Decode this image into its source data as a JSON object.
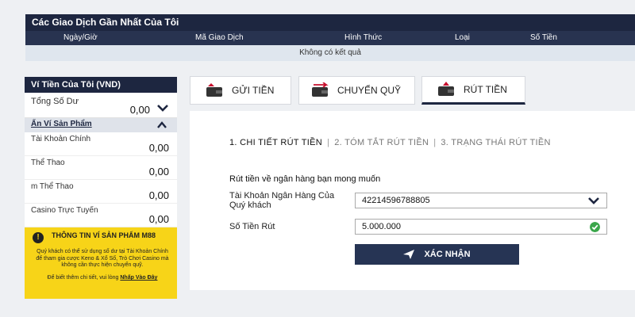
{
  "transactions": {
    "title": "Các Giao Dịch Gần Nhất Của Tôi",
    "columns": [
      "Ngày/Giờ",
      "Mã Giao Dịch",
      "Hình Thức",
      "Loại",
      "Số Tiền"
    ],
    "empty_text": "Không có kết quả"
  },
  "wallet": {
    "title": "Ví Tiền Của Tôi (VND)",
    "total_label": "Tổng Số Dư",
    "total_value": "0,00",
    "hide_label": "Ẩn Ví Sản Phẩm",
    "items": [
      {
        "label": "Tài Khoản Chính",
        "value": "0,00"
      },
      {
        "label": "Thể Thao",
        "value": "0,00"
      },
      {
        "label": "m Thể Thao",
        "value": "0,00"
      },
      {
        "label": "Casino Trực Tuyến",
        "value": "0,00"
      }
    ],
    "info": {
      "title": "THÔNG TIN VÍ SẢN PHẨM M88",
      "body": "Quý khách có thể sử dụng số dư tại Tài Khoản Chính để tham gia cược Keno & Xổ Số, Trò Chơi Casino mà không cần thực hiện chuyển quỹ.",
      "more_text": "Để biết thêm chi tiết, vui lòng",
      "more_link": "Nhấp Vào Đây"
    }
  },
  "tabs": [
    {
      "label": "GỬI TIỀN",
      "icon": "wallet-deposit-icon"
    },
    {
      "label": "CHUYỂN QUỸ",
      "icon": "wallet-transfer-icon"
    },
    {
      "label": "RÚT TIỀN",
      "icon": "wallet-withdraw-icon",
      "active": true
    }
  ],
  "withdraw": {
    "steps": [
      "1. CHI TIẾT RÚT TIỀN",
      "2. TÓM TẮT RÚT TIỀN",
      "3. TRẠNG THÁI RÚT TIỀN"
    ],
    "subtitle": "Rút tiền về ngân hàng bạn mong muốn",
    "bank_label": "Tài Khoản Ngân Hàng Của Quý khách",
    "bank_value": "42214596788805",
    "amount_label": "Số Tiền Rút",
    "amount_value": "5.000.000",
    "confirm_label": "XÁC NHẬN"
  },
  "colors": {
    "navy": "#1d2640",
    "yellow": "#f7d418",
    "success": "#3aa64a",
    "accent_red": "#c8102e"
  }
}
